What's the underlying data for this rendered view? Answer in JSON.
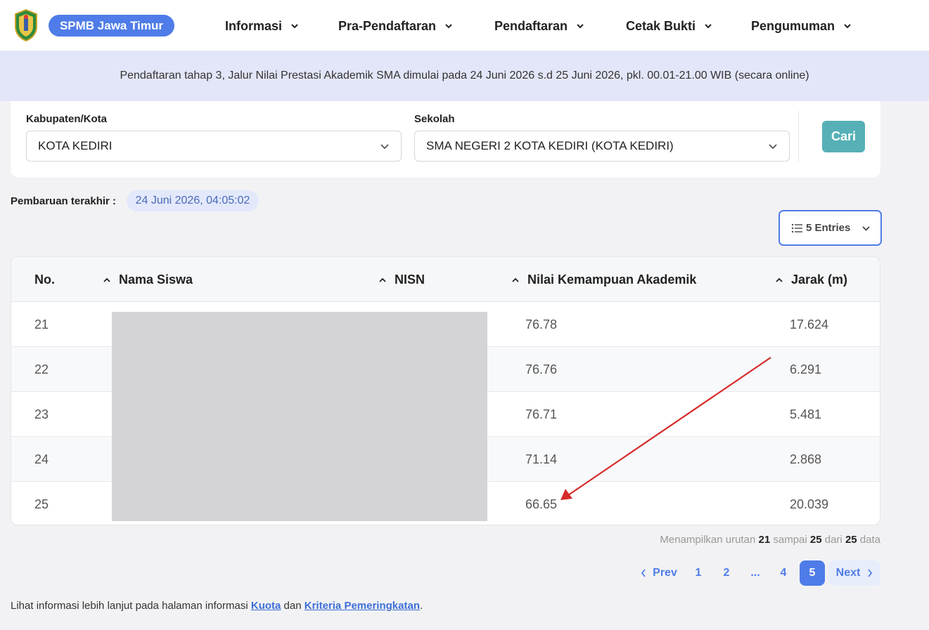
{
  "header": {
    "brand": "SPMB Jawa Timur",
    "nav": [
      {
        "label": "Informasi"
      },
      {
        "label": "Pra-Pendaftaran"
      },
      {
        "label": "Pendaftaran"
      },
      {
        "label": "Cetak Bukti"
      },
      {
        "label": "Pengumuman"
      }
    ]
  },
  "banner": {
    "text": "Pendaftaran tahap 3, Jalur Nilai Prestasi Akademik SMA dimulai pada 24 Juni 2026 s.d 25 Juni 2026, pkl. 00.01-21.00 WIB (secara online)"
  },
  "filters": {
    "kabupaten_label": "Kabupaten/Kota",
    "kabupaten_value": "KOTA KEDIRI",
    "sekolah_label": "Sekolah",
    "sekolah_value": "SMA NEGERI 2 KOTA KEDIRI (KOTA KEDIRI)",
    "search_button": "Cari"
  },
  "update": {
    "label": "Pembaruan terakhir :",
    "value": "24 Juni 2026, 04:05:02"
  },
  "entries": {
    "label": "5 Entries"
  },
  "table": {
    "columns": [
      "No.",
      "Nama Siswa",
      "NISN",
      "Nilai Kemampuan Akademik",
      "Jarak (m)"
    ],
    "rows": [
      {
        "no": "21",
        "nilai": "76.78",
        "jarak": "17.624"
      },
      {
        "no": "22",
        "nilai": "76.76",
        "jarak": "6.291"
      },
      {
        "no": "23",
        "nilai": "76.71",
        "jarak": "5.481"
      },
      {
        "no": "24",
        "nilai": "71.14",
        "jarak": "2.868"
      },
      {
        "no": "25",
        "nilai": "66.65",
        "jarak": "20.039"
      }
    ]
  },
  "summary": {
    "prefix": "Menampilkan urutan",
    "from": "21",
    "mid": "sampai",
    "to": "25",
    "of_word": "dari",
    "total": "25",
    "suffix": "data"
  },
  "pagination": {
    "prev": "Prev",
    "pages": [
      "1",
      "2",
      "...",
      "4",
      "5"
    ],
    "active": "5",
    "next": "Next"
  },
  "footer": {
    "prefix": "Lihat informasi lebih lanjut pada halaman informasi",
    "link1": "Kuota",
    "mid": "dan",
    "link2": "Kriteria Pemeringkatan",
    "suffix": "."
  },
  "colors": {
    "primary": "#4f7ce8",
    "teal": "#56b0b6",
    "banner_bg": "#e3e6f8",
    "annotation_arrow": "#d62a2a"
  }
}
